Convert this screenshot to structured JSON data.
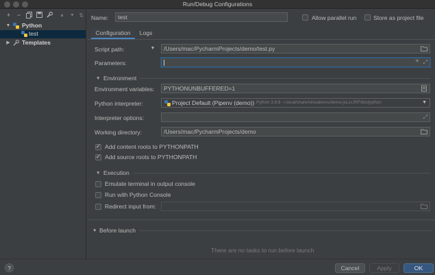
{
  "window": {
    "title": "Run/Debug Configurations"
  },
  "toolbar": {
    "add": "+",
    "remove": "−",
    "copy": "⧉",
    "save": "▣",
    "wrench": "🔧",
    "up": "▲",
    "down": "▼",
    "sort": "⇅"
  },
  "tree": {
    "python_label": "Python",
    "test_label": "test",
    "templates_label": "Templates"
  },
  "header": {
    "name_label": "Name:",
    "name_value": "test",
    "allow_parallel": "Allow parallel run",
    "store_project": "Store as project file"
  },
  "tabs": [
    {
      "label": "Configuration"
    },
    {
      "label": "Logs"
    }
  ],
  "form": {
    "script_label": "Script path:",
    "script_value": "/Users/mac/PycharmProjects/demo/test.py",
    "params_label": "Parameters:",
    "params_value": "",
    "environment_section": "Environment",
    "env_vars_label": "Environment variables:",
    "env_vars_value": "PYTHONUNBUFFERED=1",
    "interpreter_label": "Python interpreter:",
    "interpreter_value": "Project Default (Pipenv (demo))",
    "interpreter_path": "Python 3.9.8 ~/.local/share/virtualenvs/demo-jsLcvJRF/bin/python",
    "interp_options_label": "Interpreter options:",
    "interp_options_value": "",
    "workdir_label": "Working directory:",
    "workdir_value": "/Users/mac/PycharmProjects/demo",
    "content_roots": "Add content roots to PYTHONPATH",
    "source_roots": "Add source roots to PYTHONPATH",
    "execution_section": "Execution",
    "emulate_terminal": "Emulate terminal in output console",
    "run_console": "Run with Python Console",
    "redirect_input": "Redirect input from:",
    "redirect_value": "",
    "before_launch": "Before launch",
    "no_tasks": "There are no tasks to run before launch"
  },
  "buttons": {
    "help": "?",
    "cancel": "Cancel",
    "apply": "Apply",
    "ok": "OK"
  }
}
